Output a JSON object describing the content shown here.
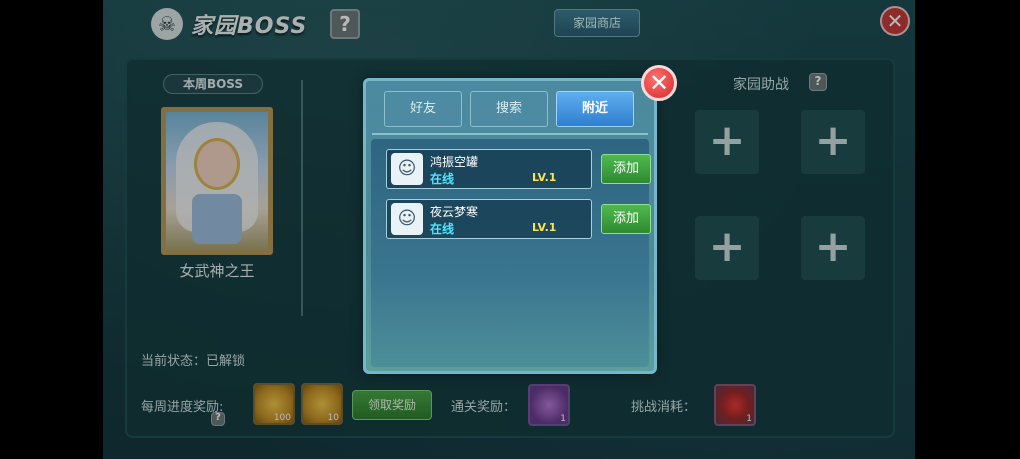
{
  "header": {
    "title": "家园BOSS",
    "help_label": "?",
    "shop_label": "家园商店",
    "close_label": "✕"
  },
  "boss_panel": {
    "tag": "本周BOSS",
    "boss_name": "女武神之王"
  },
  "assist_panel": {
    "title": "家园助战",
    "help_label": "?",
    "slot_symbol": "+"
  },
  "footer": {
    "status_label": "当前状态：已解锁",
    "weekly_reward_label": "每周进度奖励:",
    "weekly_help": "?",
    "claim_label": "领取奖励",
    "coin1_count": "100",
    "coin2_count": "10",
    "clear_reward_label": "通关奖励：",
    "clear_reward_count": "1",
    "challenge_cost_label": "挑战消耗：",
    "challenge_cost_count": "1"
  },
  "dialog": {
    "close_label": "✕",
    "tabs": [
      {
        "label": "好友",
        "active": false
      },
      {
        "label": "搜索",
        "active": false
      },
      {
        "label": "附近",
        "active": true
      }
    ],
    "friends": [
      {
        "name": "鸿振空罐",
        "status": "在线",
        "level": "LV.1",
        "add_label": "添加"
      },
      {
        "name": "夜云梦寒",
        "status": "在线",
        "level": "LV.1",
        "add_label": "添加"
      }
    ]
  }
}
